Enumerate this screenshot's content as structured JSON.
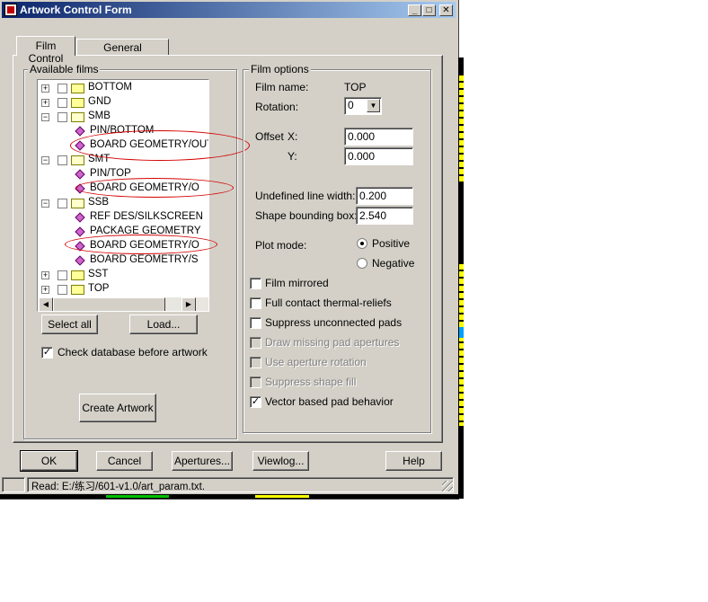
{
  "window": {
    "title": "Artwork Control Form"
  },
  "title_buttons": {
    "minimize": "_",
    "maximize": "□",
    "close": "✕"
  },
  "tabs": [
    {
      "label": "Film Control"
    },
    {
      "label": "General Parameters"
    }
  ],
  "available_films": {
    "label": "Available films",
    "nodes": [
      {
        "label": "BOTTOM",
        "expander": "+"
      },
      {
        "label": "GND",
        "expander": "+"
      },
      {
        "label": "SMB",
        "expander": "−"
      },
      {
        "label": "PIN/BOTTOM"
      },
      {
        "label": "BOARD GEOMETRY/OUTLINE"
      },
      {
        "label": "SMT",
        "expander": "−"
      },
      {
        "label": "PIN/TOP"
      },
      {
        "label": "BOARD GEOMETRY/O"
      },
      {
        "label": "SSB",
        "expander": "−"
      },
      {
        "label": "REF DES/SILKSCREEN"
      },
      {
        "label": "PACKAGE GEOMETRY"
      },
      {
        "label": "BOARD GEOMETRY/O"
      },
      {
        "label": "BOARD GEOMETRY/S"
      },
      {
        "label": "SST",
        "expander": "+"
      },
      {
        "label": "TOP",
        "expander": "+"
      }
    ]
  },
  "buttons": {
    "select_all": "Select all",
    "load": "Load...",
    "create_artwork": "Create Artwork",
    "ok": "OK",
    "cancel": "Cancel",
    "apertures": "Apertures...",
    "viewlog": "Viewlog...",
    "help": "Help"
  },
  "check_db": {
    "label": "Check database before artwork",
    "checked": true,
    "mark": "✓"
  },
  "film_options": {
    "label": "Film options",
    "film_name_label": "Film name:",
    "film_name_value": "TOP",
    "rotation_label": "Rotation:",
    "rotation_value": "0",
    "offset_label": "Offset",
    "offset_x_label": "X:",
    "offset_x_value": "0.000",
    "offset_y_label": "Y:",
    "offset_y_value": "0.000",
    "undefined_line_width_label": "Undefined line width:",
    "undefined_line_width_value": "0.200",
    "shape_bounding_box_label": "Shape bounding box:",
    "shape_bounding_box_value": "2.540",
    "plot_mode_label": "Plot mode:",
    "plot_mode_positive": "Positive",
    "plot_mode_negative": "Negative",
    "checkboxes": [
      {
        "label": "Film mirrored",
        "checked": false,
        "enabled": true
      },
      {
        "label": "Full contact thermal-reliefs",
        "checked": false,
        "enabled": true
      },
      {
        "label": "Suppress unconnected pads",
        "checked": false,
        "enabled": true
      },
      {
        "label": "Draw missing pad apertures",
        "checked": false,
        "enabled": false
      },
      {
        "label": "Use aperture rotation",
        "checked": false,
        "enabled": false
      },
      {
        "label": "Suppress shape fill",
        "checked": false,
        "enabled": false
      },
      {
        "label": "Vector based pad behavior",
        "checked": true,
        "enabled": true,
        "mark": "✓"
      }
    ]
  },
  "status": {
    "text": "Read: E:/练习/601-v1.0/art_param.txt."
  },
  "colors": {
    "title_start": "#0a246a",
    "title_end": "#a6caf0",
    "face": "#d4d0c8",
    "highlight_ellipse": "#d40000"
  }
}
